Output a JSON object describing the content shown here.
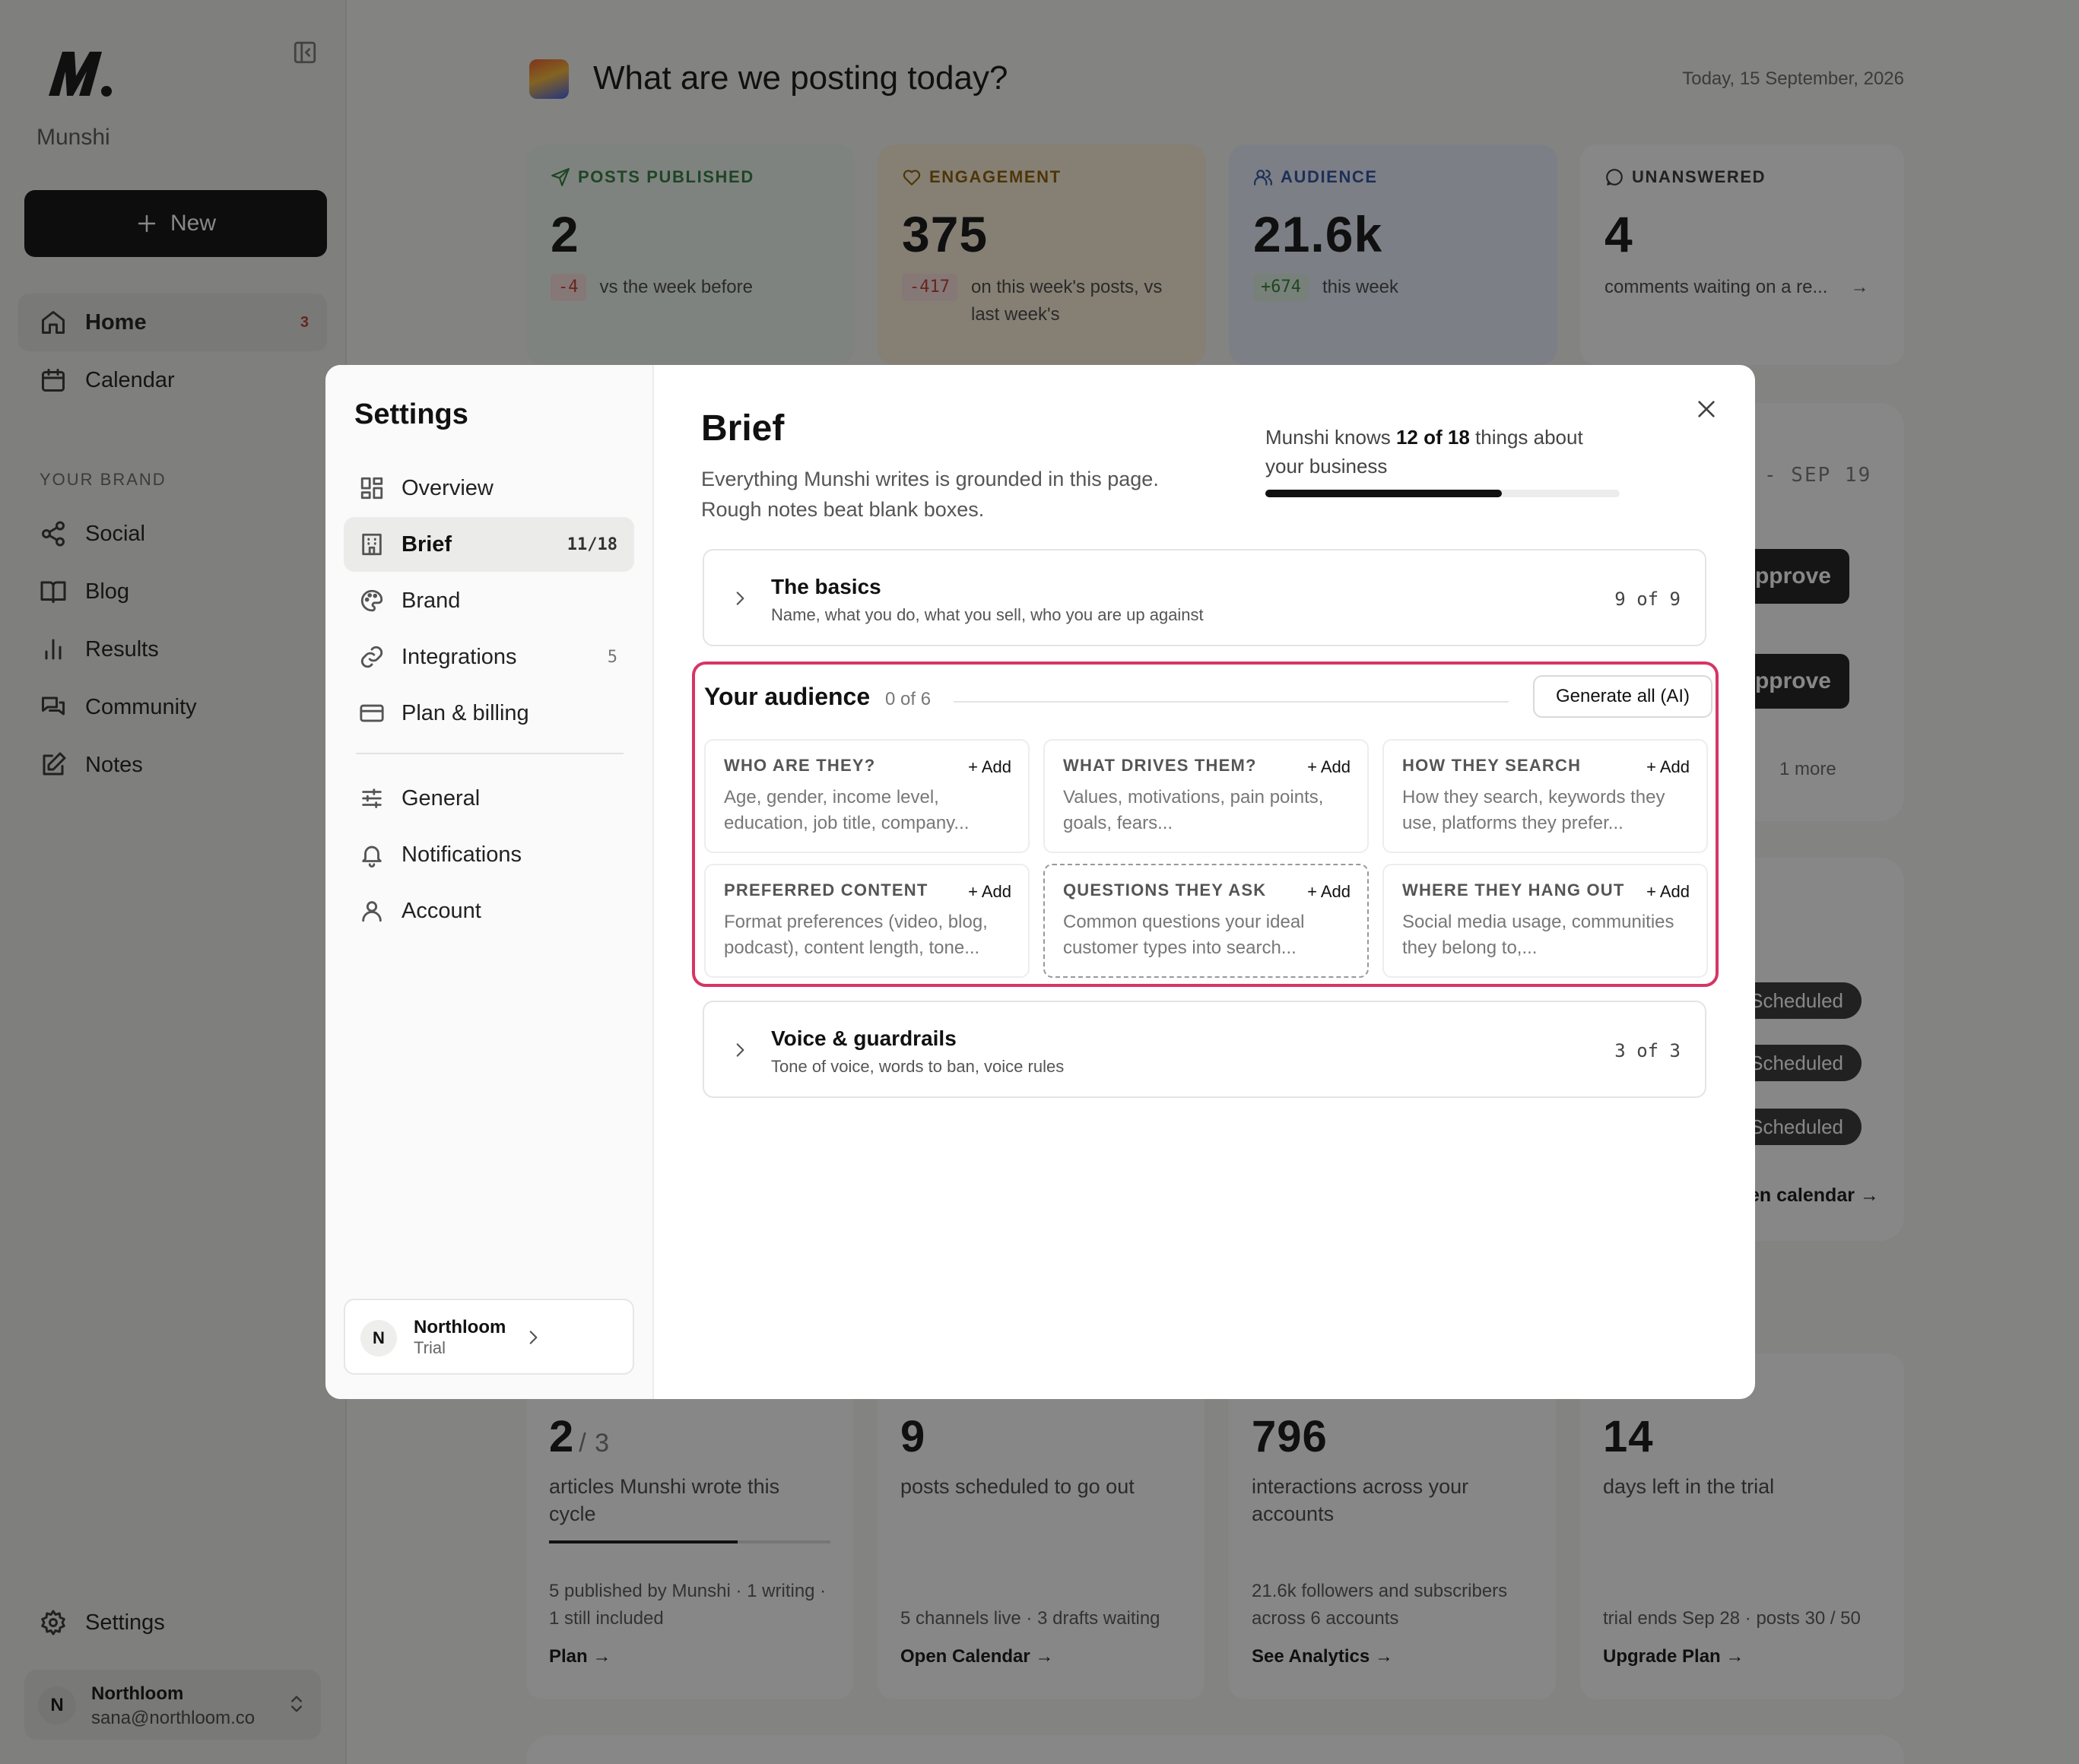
{
  "sidebar": {
    "brand_name": "Munshi",
    "new_label": "New",
    "nav": [
      {
        "label": "Home",
        "badge": "3"
      },
      {
        "label": "Calendar"
      }
    ],
    "section_label": "YOUR BRAND",
    "brand_nav": [
      {
        "label": "Social"
      },
      {
        "label": "Blog"
      },
      {
        "label": "Results"
      },
      {
        "label": "Community"
      },
      {
        "label": "Notes"
      }
    ],
    "settings_label": "Settings",
    "user": {
      "initial": "N",
      "name": "Northloom",
      "email": "sana@northloom.co"
    }
  },
  "main": {
    "title": "What are we posting today?",
    "date": "Today, 15 September, 2026",
    "stats": [
      {
        "label": "POSTS PUBLISHED",
        "value": "2",
        "delta": "-4",
        "note": "vs the week before",
        "color": "#2f7a3d",
        "bg": "#eef6ef"
      },
      {
        "label": "ENGAGEMENT",
        "value": "375",
        "delta": "-417",
        "note": "on this week's posts, vs last week's",
        "color": "#8a5a00",
        "bg": "#fdf1d8"
      },
      {
        "label": "AUDIENCE",
        "value": "21.6k",
        "delta": "+674",
        "note": "this week",
        "color": "#2b4fa0",
        "bg": "#e9eefb"
      },
      {
        "label": "UNANSWERED",
        "value": "4",
        "note": "comments waiting on a re...",
        "color": "#333333",
        "bg": "#ffffff"
      }
    ],
    "peek": {
      "date_range": "- SEP 19",
      "approve_label": "pprove",
      "more_label": "1 more",
      "scheduled_label": "Scheduled",
      "calendar_link": "en calendar →"
    },
    "bottom_stats": [
      {
        "value": "2",
        "total": "/ 3",
        "desc": "articles Munshi wrote this cycle",
        "progress": 0.67,
        "foot": "5 published by Munshi · 1 writing · 1 still included",
        "link": "Plan →"
      },
      {
        "value": "9",
        "desc": "posts scheduled to go out",
        "foot": "5 channels live · 3 drafts waiting",
        "link": "Open Calendar →"
      },
      {
        "value": "796",
        "desc": "interactions across your accounts",
        "foot": "21.6k followers and subscribers across 6 accounts",
        "link": "See Analytics →"
      },
      {
        "value": "14",
        "desc": "days left in the trial",
        "foot": "trial ends Sep 28 · posts 30 / 50",
        "link": "Upgrade Plan →"
      }
    ]
  },
  "settings": {
    "title": "Settings",
    "nav": [
      {
        "label": "Overview"
      },
      {
        "label": "Brief",
        "badge": "11/18"
      },
      {
        "label": "Brand"
      },
      {
        "label": "Integrations",
        "badge": "5"
      },
      {
        "label": "Plan & billing"
      }
    ],
    "nav2": [
      {
        "label": "General"
      },
      {
        "label": "Notifications"
      },
      {
        "label": "Account"
      }
    ],
    "workspace": {
      "initial": "N",
      "name": "Northloom",
      "plan": "Trial"
    }
  },
  "brief": {
    "title": "Brief",
    "desc": "Everything Munshi writes is grounded in this page. Rough notes beat blank boxes.",
    "know_prefix": "Munshi knows",
    "know_count": "12 of 18",
    "know_suffix": "things about your business",
    "know_progress": 0.667,
    "basics": {
      "title": "The basics",
      "sub": "Name, what you do, what you sell, who you are up against",
      "count": "9 of 9"
    },
    "audience": {
      "title": "Your audience",
      "count": "0 of 6",
      "generate_label": "Generate all (AI)",
      "add_label": "+ Add",
      "fields": [
        {
          "label": "WHO ARE THEY?",
          "placeholder": "Age, gender, income level, education, job title, company..."
        },
        {
          "label": "WHAT DRIVES THEM?",
          "placeholder": "Values, motivations, pain points, goals, fears..."
        },
        {
          "label": "HOW THEY SEARCH",
          "placeholder": "How they search, keywords they use, platforms they prefer..."
        },
        {
          "label": "PREFERRED CONTENT",
          "placeholder": "Format preferences (video, blog, podcast), content length, tone..."
        },
        {
          "label": "QUESTIONS THEY ASK",
          "placeholder": "Common questions your ideal customer types into search..."
        },
        {
          "label": "WHERE THEY HANG OUT",
          "placeholder": "Social media usage, communities they belong to,..."
        }
      ]
    },
    "voice": {
      "title": "Voice & guardrails",
      "sub": "Tone of voice, words to ban, voice rules",
      "count": "3 of 3"
    }
  }
}
